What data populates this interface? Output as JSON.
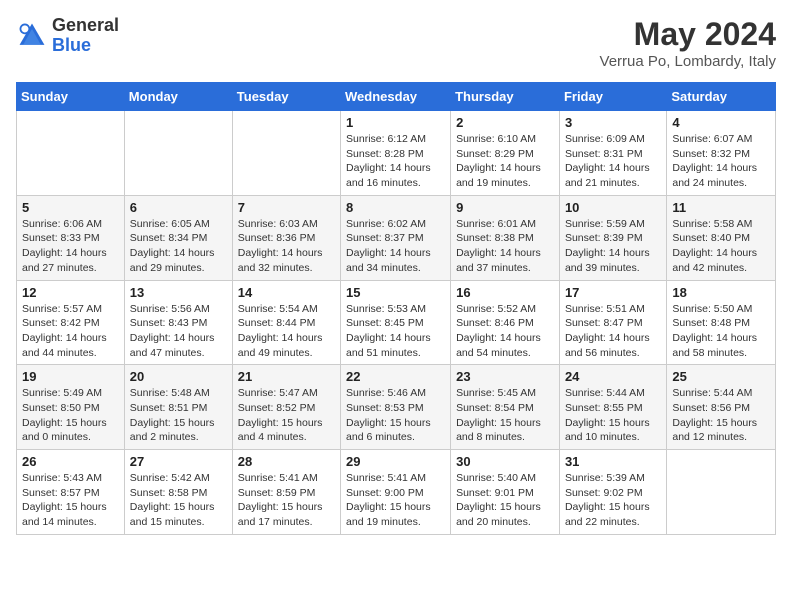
{
  "header": {
    "logo_general": "General",
    "logo_blue": "Blue",
    "title": "May 2024",
    "subtitle": "Verrua Po, Lombardy, Italy"
  },
  "days_of_week": [
    "Sunday",
    "Monday",
    "Tuesday",
    "Wednesday",
    "Thursday",
    "Friday",
    "Saturday"
  ],
  "weeks": [
    [
      {
        "day": "",
        "info": ""
      },
      {
        "day": "",
        "info": ""
      },
      {
        "day": "",
        "info": ""
      },
      {
        "day": "1",
        "info": "Sunrise: 6:12 AM\nSunset: 8:28 PM\nDaylight: 14 hours and 16 minutes."
      },
      {
        "day": "2",
        "info": "Sunrise: 6:10 AM\nSunset: 8:29 PM\nDaylight: 14 hours and 19 minutes."
      },
      {
        "day": "3",
        "info": "Sunrise: 6:09 AM\nSunset: 8:31 PM\nDaylight: 14 hours and 21 minutes."
      },
      {
        "day": "4",
        "info": "Sunrise: 6:07 AM\nSunset: 8:32 PM\nDaylight: 14 hours and 24 minutes."
      }
    ],
    [
      {
        "day": "5",
        "info": "Sunrise: 6:06 AM\nSunset: 8:33 PM\nDaylight: 14 hours and 27 minutes."
      },
      {
        "day": "6",
        "info": "Sunrise: 6:05 AM\nSunset: 8:34 PM\nDaylight: 14 hours and 29 minutes."
      },
      {
        "day": "7",
        "info": "Sunrise: 6:03 AM\nSunset: 8:36 PM\nDaylight: 14 hours and 32 minutes."
      },
      {
        "day": "8",
        "info": "Sunrise: 6:02 AM\nSunset: 8:37 PM\nDaylight: 14 hours and 34 minutes."
      },
      {
        "day": "9",
        "info": "Sunrise: 6:01 AM\nSunset: 8:38 PM\nDaylight: 14 hours and 37 minutes."
      },
      {
        "day": "10",
        "info": "Sunrise: 5:59 AM\nSunset: 8:39 PM\nDaylight: 14 hours and 39 minutes."
      },
      {
        "day": "11",
        "info": "Sunrise: 5:58 AM\nSunset: 8:40 PM\nDaylight: 14 hours and 42 minutes."
      }
    ],
    [
      {
        "day": "12",
        "info": "Sunrise: 5:57 AM\nSunset: 8:42 PM\nDaylight: 14 hours and 44 minutes."
      },
      {
        "day": "13",
        "info": "Sunrise: 5:56 AM\nSunset: 8:43 PM\nDaylight: 14 hours and 47 minutes."
      },
      {
        "day": "14",
        "info": "Sunrise: 5:54 AM\nSunset: 8:44 PM\nDaylight: 14 hours and 49 minutes."
      },
      {
        "day": "15",
        "info": "Sunrise: 5:53 AM\nSunset: 8:45 PM\nDaylight: 14 hours and 51 minutes."
      },
      {
        "day": "16",
        "info": "Sunrise: 5:52 AM\nSunset: 8:46 PM\nDaylight: 14 hours and 54 minutes."
      },
      {
        "day": "17",
        "info": "Sunrise: 5:51 AM\nSunset: 8:47 PM\nDaylight: 14 hours and 56 minutes."
      },
      {
        "day": "18",
        "info": "Sunrise: 5:50 AM\nSunset: 8:48 PM\nDaylight: 14 hours and 58 minutes."
      }
    ],
    [
      {
        "day": "19",
        "info": "Sunrise: 5:49 AM\nSunset: 8:50 PM\nDaylight: 15 hours and 0 minutes."
      },
      {
        "day": "20",
        "info": "Sunrise: 5:48 AM\nSunset: 8:51 PM\nDaylight: 15 hours and 2 minutes."
      },
      {
        "day": "21",
        "info": "Sunrise: 5:47 AM\nSunset: 8:52 PM\nDaylight: 15 hours and 4 minutes."
      },
      {
        "day": "22",
        "info": "Sunrise: 5:46 AM\nSunset: 8:53 PM\nDaylight: 15 hours and 6 minutes."
      },
      {
        "day": "23",
        "info": "Sunrise: 5:45 AM\nSunset: 8:54 PM\nDaylight: 15 hours and 8 minutes."
      },
      {
        "day": "24",
        "info": "Sunrise: 5:44 AM\nSunset: 8:55 PM\nDaylight: 15 hours and 10 minutes."
      },
      {
        "day": "25",
        "info": "Sunrise: 5:44 AM\nSunset: 8:56 PM\nDaylight: 15 hours and 12 minutes."
      }
    ],
    [
      {
        "day": "26",
        "info": "Sunrise: 5:43 AM\nSunset: 8:57 PM\nDaylight: 15 hours and 14 minutes."
      },
      {
        "day": "27",
        "info": "Sunrise: 5:42 AM\nSunset: 8:58 PM\nDaylight: 15 hours and 15 minutes."
      },
      {
        "day": "28",
        "info": "Sunrise: 5:41 AM\nSunset: 8:59 PM\nDaylight: 15 hours and 17 minutes."
      },
      {
        "day": "29",
        "info": "Sunrise: 5:41 AM\nSunset: 9:00 PM\nDaylight: 15 hours and 19 minutes."
      },
      {
        "day": "30",
        "info": "Sunrise: 5:40 AM\nSunset: 9:01 PM\nDaylight: 15 hours and 20 minutes."
      },
      {
        "day": "31",
        "info": "Sunrise: 5:39 AM\nSunset: 9:02 PM\nDaylight: 15 hours and 22 minutes."
      },
      {
        "day": "",
        "info": ""
      }
    ]
  ]
}
